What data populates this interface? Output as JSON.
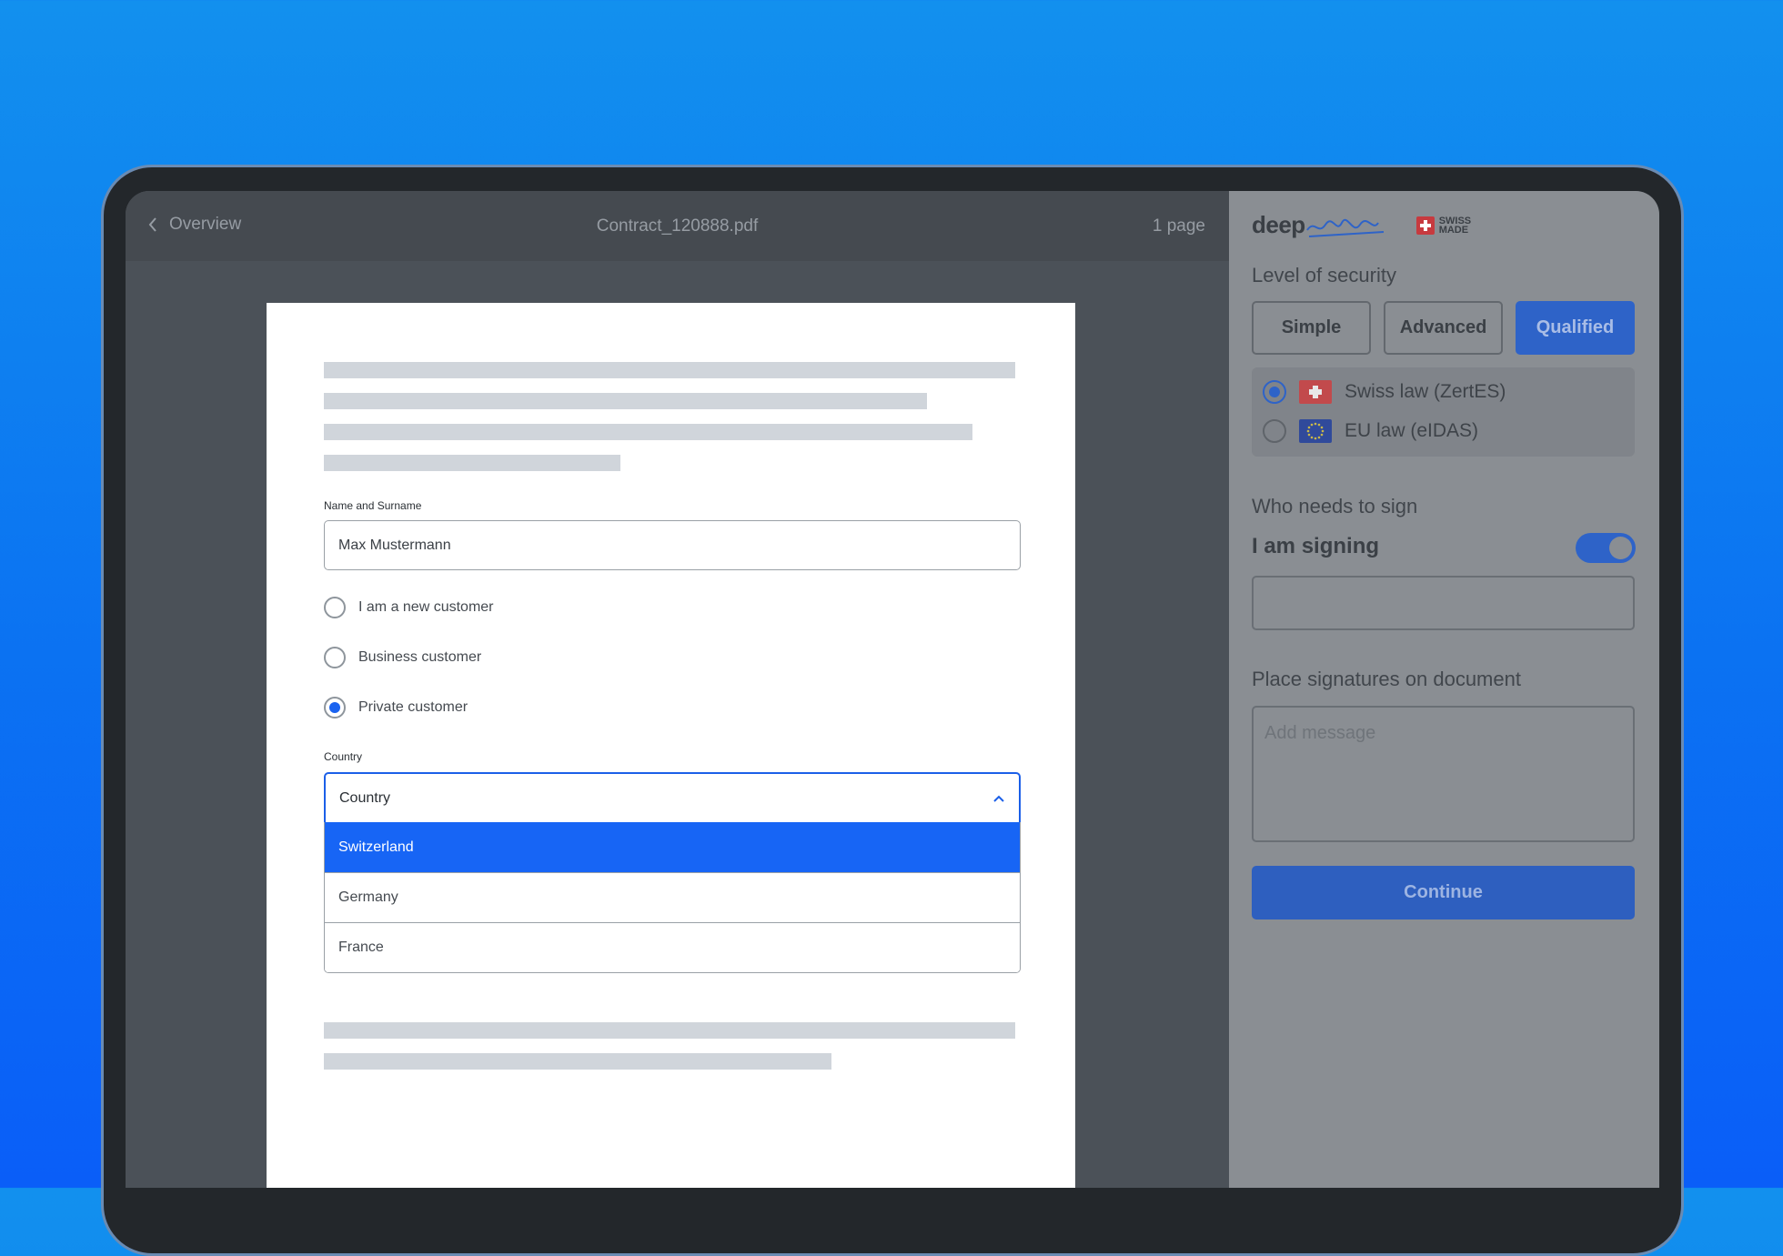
{
  "viewer": {
    "back_label": "Overview",
    "filename": "Contract_120888.pdf",
    "page_count": "1 page"
  },
  "form": {
    "name_label": "Name and Surname",
    "name_value": "Max Mustermann",
    "customer_options": [
      {
        "label": "I am a new customer",
        "checked": false
      },
      {
        "label": "Business customer",
        "checked": false
      },
      {
        "label": "Private customer",
        "checked": true
      }
    ],
    "country_label": "Country",
    "country_placeholder": "Country",
    "country_options": [
      {
        "label": "Switzerland",
        "selected": true
      },
      {
        "label": "Germany",
        "selected": false
      },
      {
        "label": "France",
        "selected": false
      }
    ]
  },
  "panel": {
    "logo_prefix": "deep",
    "swiss_made_line1": "SWISS",
    "swiss_made_line2": "MADE",
    "security_title": "Level of security",
    "security_levels": [
      {
        "label": "Simple",
        "active": false
      },
      {
        "label": "Advanced",
        "active": false
      },
      {
        "label": "Qualified",
        "active": true
      }
    ],
    "laws": [
      {
        "label": "Swiss law (ZertES)",
        "checked": true,
        "flag": "swiss-flag-icon"
      },
      {
        "label": "EU law (eIDAS)",
        "checked": false,
        "flag": "eu-flag-icon"
      }
    ],
    "who_title": "Who needs to sign",
    "signing_label": "I am signing",
    "signing_toggle_on": true,
    "place_title": "Place signatures on document",
    "message_placeholder": "Add message",
    "continue_label": "Continue"
  },
  "colors": {
    "background_top": "#1290ee",
    "background_bottom": "#0a5ef8",
    "accent": "#1765f5",
    "panel_accent": "#2e63c8"
  }
}
